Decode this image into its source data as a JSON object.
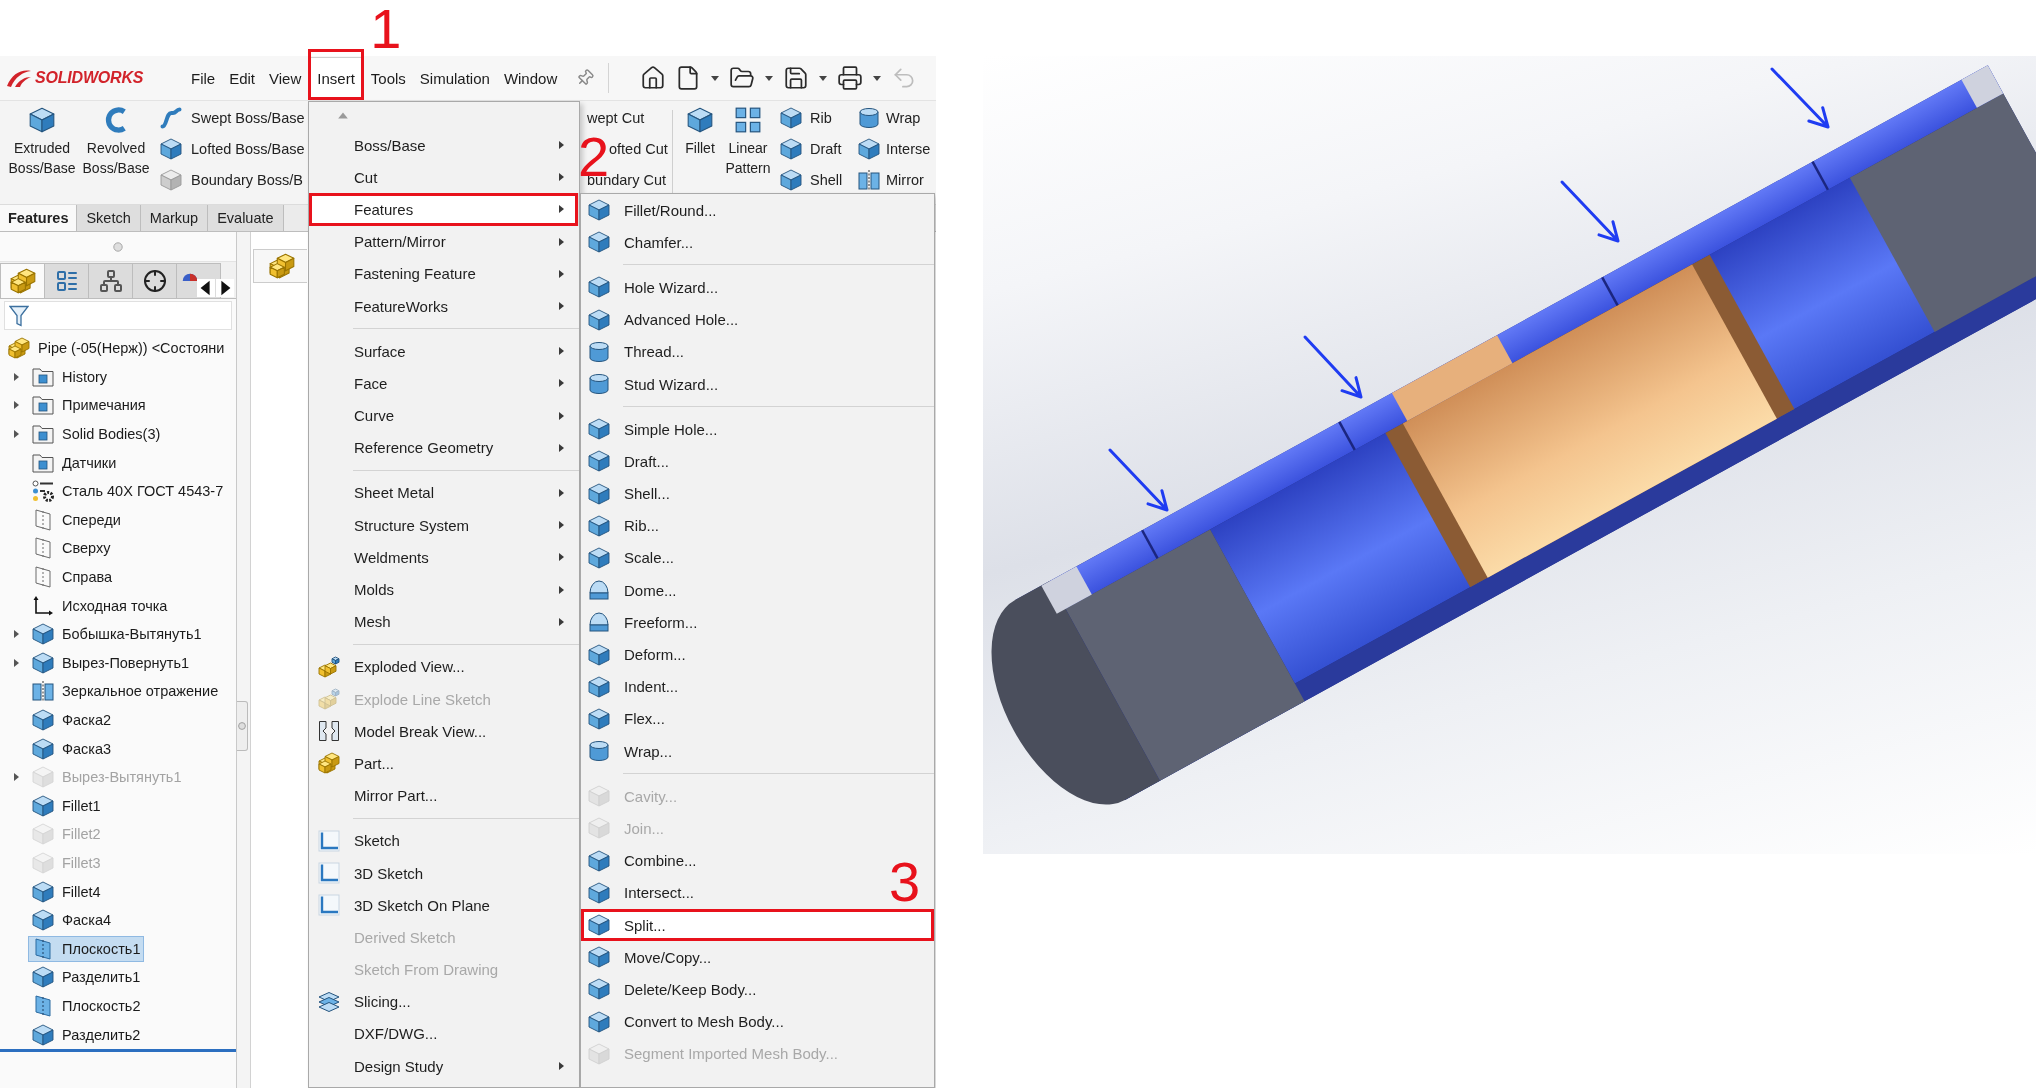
{
  "menu_bar": {
    "logo": "SOLIDWORKS",
    "items": [
      {
        "label": "File",
        "selected": false
      },
      {
        "label": "Edit",
        "selected": false
      },
      {
        "label": "View",
        "selected": false
      },
      {
        "label": "Insert",
        "selected": true,
        "callout": "1"
      },
      {
        "label": "Tools",
        "selected": false
      },
      {
        "label": "Simulation",
        "selected": false
      },
      {
        "label": "Window",
        "selected": false
      }
    ]
  },
  "quick_access_toolbar": [
    {
      "disabled": false
    },
    {
      "disabled": false
    },
    {
      "disabled": false
    },
    {
      "disabled": false
    },
    {
      "disabled": false
    },
    {
      "disabled": true
    }
  ],
  "ribbon": {
    "large_buttons": [
      {
        "label": "Extruded Boss/Base"
      },
      {
        "label": "Revolved Boss/Base"
      }
    ],
    "boss_column": [
      "Swept Boss/Base",
      "Lofted Boss/Base",
      "Boundary Boss/B"
    ],
    "cut_column": [
      "wept Cut",
      "ofted Cut",
      "bundary Cut"
    ],
    "feature_buttons": [
      {
        "label": "Fillet"
      },
      {
        "label": "Linear Pattern"
      }
    ],
    "small_columns": [
      [
        "Rib",
        "Draft",
        "Shell"
      ],
      [
        "Wrap",
        "Interse",
        "Mirror"
      ]
    ]
  },
  "command_tabs": [
    {
      "label": "Features",
      "selected": true
    },
    {
      "label": "Sketch",
      "selected": false
    },
    {
      "label": "Markup",
      "selected": false
    },
    {
      "label": "Evaluate",
      "selected": false
    }
  ],
  "feature_manager": {
    "tabs": [
      {
        "selected": true
      },
      {
        "selected": false
      },
      {
        "selected": false
      },
      {
        "selected": false
      },
      {
        "selected": false
      }
    ],
    "tree": {
      "label": "Pipe (-05(Нерж)) <Состояни",
      "selected": false,
      "disabled": false,
      "children": [
        {
          "label": "History",
          "expandable": true,
          "selected": false,
          "disabled": false
        },
        {
          "label": "Примечания",
          "expandable": true,
          "selected": false,
          "disabled": false
        },
        {
          "label": "Solid Bodies(3)",
          "expandable": true,
          "selected": false,
          "disabled": false
        },
        {
          "label": "Датчики",
          "expandable": false,
          "selected": false,
          "disabled": false
        },
        {
          "label": "Сталь 40Х ГОСТ 4543-7",
          "expandable": false,
          "selected": false,
          "disabled": false
        },
        {
          "label": "Спереди",
          "expandable": false,
          "selected": false,
          "disabled": false
        },
        {
          "label": "Сверху",
          "expandable": false,
          "selected": false,
          "disabled": false
        },
        {
          "label": "Справа",
          "expandable": false,
          "selected": false,
          "disabled": false
        },
        {
          "label": "Исходная точка",
          "expandable": false,
          "selected": false,
          "disabled": false
        },
        {
          "label": "Бобышка-Вытянуть1",
          "expandable": true,
          "selected": false,
          "disabled": false
        },
        {
          "label": "Вырез-Повернуть1",
          "expandable": true,
          "selected": false,
          "disabled": false
        },
        {
          "label": "Зеркальное отражение",
          "expandable": false,
          "selected": false,
          "disabled": false
        },
        {
          "label": "Фаска2",
          "expandable": false,
          "selected": false,
          "disabled": false
        },
        {
          "label": "Фаска3",
          "expandable": false,
          "selected": false,
          "disabled": false
        },
        {
          "label": "Вырез-Вытянуть1",
          "expandable": true,
          "selected": false,
          "disabled": true
        },
        {
          "label": "Fillet1",
          "expandable": false,
          "selected": false,
          "disabled": false
        },
        {
          "label": "Fillet2",
          "expandable": false,
          "selected": false,
          "disabled": true
        },
        {
          "label": "Fillet3",
          "expandable": false,
          "selected": false,
          "disabled": true
        },
        {
          "label": "Fillet4",
          "expandable": false,
          "selected": false,
          "disabled": false
        },
        {
          "label": "Фаска4",
          "expandable": false,
          "selected": false,
          "disabled": false
        },
        {
          "label": "Плоскость1",
          "expandable": false,
          "selected": true,
          "disabled": false
        },
        {
          "label": "Разделить1",
          "expandable": false,
          "selected": false,
          "disabled": false
        },
        {
          "label": "Плоскость2",
          "expandable": false,
          "selected": false,
          "disabled": false
        },
        {
          "label": "Разделить2",
          "expandable": false,
          "selected": false,
          "disabled": false
        }
      ]
    }
  },
  "insert_menu": {
    "sections": [
      [
        {
          "label": "Boss/Base",
          "submenu": true,
          "disabled": false,
          "selected": false
        },
        {
          "label": "Cut",
          "submenu": true,
          "disabled": false,
          "selected": false
        },
        {
          "label": "Features",
          "submenu": true,
          "disabled": false,
          "selected": true,
          "callout": "2"
        },
        {
          "label": "Pattern/Mirror",
          "submenu": true,
          "disabled": false,
          "selected": false
        },
        {
          "label": "Fastening Feature",
          "submenu": true,
          "disabled": false,
          "selected": false
        },
        {
          "label": "FeatureWorks",
          "submenu": true,
          "disabled": false,
          "selected": false
        }
      ],
      [
        {
          "label": "Surface",
          "submenu": true,
          "disabled": false,
          "selected": false
        },
        {
          "label": "Face",
          "submenu": true,
          "disabled": false,
          "selected": false
        },
        {
          "label": "Curve",
          "submenu": true,
          "disabled": false,
          "selected": false
        },
        {
          "label": "Reference Geometry",
          "submenu": true,
          "disabled": false,
          "selected": false
        }
      ],
      [
        {
          "label": "Sheet Metal",
          "submenu": true,
          "disabled": false,
          "selected": false
        },
        {
          "label": "Structure System",
          "submenu": true,
          "disabled": false,
          "selected": false
        },
        {
          "label": "Weldments",
          "submenu": true,
          "disabled": false,
          "selected": false
        },
        {
          "label": "Molds",
          "submenu": true,
          "disabled": false,
          "selected": false
        },
        {
          "label": "Mesh",
          "submenu": true,
          "disabled": false,
          "selected": false
        }
      ],
      [
        {
          "label": "Exploded View...",
          "submenu": false,
          "disabled": false,
          "selected": false
        },
        {
          "label": "Explode Line Sketch",
          "submenu": false,
          "disabled": true,
          "selected": false
        },
        {
          "label": "Model Break View...",
          "submenu": false,
          "disabled": false,
          "selected": false
        },
        {
          "label": "Part...",
          "submenu": false,
          "disabled": false,
          "selected": false
        },
        {
          "label": "Mirror Part...",
          "submenu": false,
          "disabled": false,
          "selected": false
        }
      ],
      [
        {
          "label": "Sketch",
          "submenu": false,
          "disabled": false,
          "selected": false
        },
        {
          "label": "3D Sketch",
          "submenu": false,
          "disabled": false,
          "selected": false
        },
        {
          "label": "3D Sketch On Plane",
          "submenu": false,
          "disabled": false,
          "selected": false
        },
        {
          "label": "Derived Sketch",
          "submenu": false,
          "disabled": true,
          "selected": false
        },
        {
          "label": "Sketch From Drawing",
          "submenu": false,
          "disabled": true,
          "selected": false
        },
        {
          "label": "Slicing...",
          "submenu": false,
          "disabled": false,
          "selected": false
        },
        {
          "label": "DXF/DWG...",
          "submenu": false,
          "disabled": false,
          "selected": false
        },
        {
          "label": "Design Study",
          "submenu": true,
          "disabled": false,
          "selected": false
        }
      ]
    ]
  },
  "features_submenu": {
    "sections": [
      [
        {
          "label": "Fillet/Round...",
          "disabled": false,
          "selected": false
        },
        {
          "label": "Chamfer...",
          "disabled": false,
          "selected": false
        }
      ],
      [
        {
          "label": "Hole Wizard...",
          "disabled": false,
          "selected": false
        },
        {
          "label": "Advanced Hole...",
          "disabled": false,
          "selected": false
        },
        {
          "label": "Thread...",
          "disabled": false,
          "selected": false
        },
        {
          "label": "Stud Wizard...",
          "disabled": false,
          "selected": false
        }
      ],
      [
        {
          "label": "Simple Hole...",
          "disabled": false,
          "selected": false
        },
        {
          "label": "Draft...",
          "disabled": false,
          "selected": false
        },
        {
          "label": "Shell...",
          "disabled": false,
          "selected": false
        },
        {
          "label": "Rib...",
          "disabled": false,
          "selected": false
        },
        {
          "label": "Scale...",
          "disabled": false,
          "selected": false
        },
        {
          "label": "Dome...",
          "disabled": false,
          "selected": false
        },
        {
          "label": "Freeform...",
          "disabled": false,
          "selected": false
        },
        {
          "label": "Deform...",
          "disabled": false,
          "selected": false
        },
        {
          "label": "Indent...",
          "disabled": false,
          "selected": false
        },
        {
          "label": "Flex...",
          "disabled": false,
          "selected": false
        },
        {
          "label": "Wrap...",
          "disabled": false,
          "selected": false
        }
      ],
      [
        {
          "label": "Cavity...",
          "disabled": true,
          "selected": false
        },
        {
          "label": "Join...",
          "disabled": true,
          "selected": false
        },
        {
          "label": "Combine...",
          "disabled": false,
          "selected": false
        },
        {
          "label": "Intersect...",
          "disabled": false,
          "selected": false
        },
        {
          "label": "Split...",
          "disabled": false,
          "selected": true,
          "callout": "3"
        },
        {
          "label": "Move/Copy...",
          "disabled": false,
          "selected": false
        },
        {
          "label": "Delete/Keep Body...",
          "disabled": false,
          "selected": false
        },
        {
          "label": "Convert to Mesh Body...",
          "disabled": false,
          "selected": false
        },
        {
          "label": "Segment Imported Mesh Body...",
          "disabled": true,
          "selected": false
        }
      ]
    ]
  }
}
